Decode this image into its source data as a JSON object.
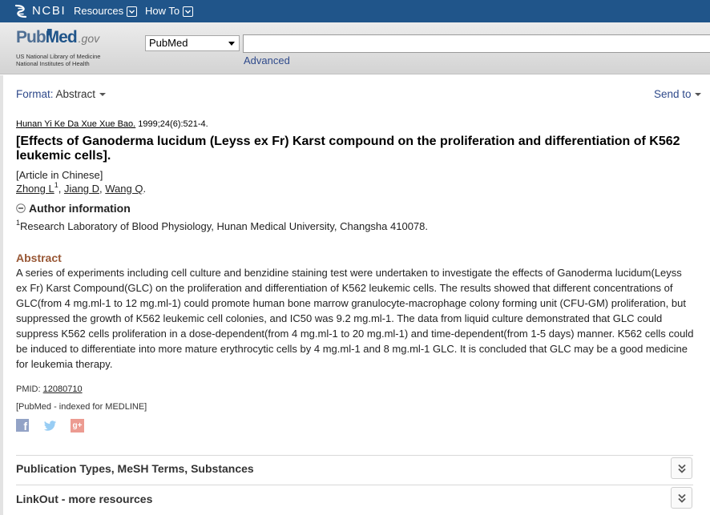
{
  "colors": {
    "ncbi_bar": "#20558a",
    "link": "#2f4a8b",
    "abstract_heading": "#985735"
  },
  "ncbi_bar": {
    "logo_text": "NCBI",
    "logo_icon": "ncbi-helix-icon",
    "menus": [
      {
        "label": "Resources",
        "icon": "chevron-down-icon"
      },
      {
        "label": "How To",
        "icon": "chevron-down-icon"
      }
    ]
  },
  "header": {
    "logo": {
      "pub": "Pub",
      "med": "Med",
      "gov": ".gov",
      "line1": "US National Library of Medicine",
      "line2": "National Institutes of Health"
    },
    "database_select": {
      "value": "PubMed"
    },
    "search": {
      "value": ""
    },
    "advanced_label": "Advanced"
  },
  "format_bar": {
    "format_label": "Format:",
    "format_value": "Abstract",
    "send_to_label": "Send to"
  },
  "article": {
    "journal": "Hunan Yi Ke Da Xue Xue Bao.",
    "citation": "1999;24(6):521-4.",
    "title": "[Effects of Ganoderma lucidum (Leyss ex Fr) Karst compound on the proliferation and differentiation of K562 leukemic cells].",
    "language_note": "[Article in Chinese]",
    "authors": [
      {
        "name": "Zhong L",
        "sup": "1",
        "sep": ", "
      },
      {
        "name": "Jiang D",
        "sep": ", "
      },
      {
        "name": "Wang Q",
        "sep": "."
      }
    ],
    "author_info_label": "Author information",
    "author_info_icon": "minus-circle-icon",
    "affiliation": {
      "sup": "1",
      "text": "Research Laboratory of Blood Physiology, Hunan Medical University, Changsha 410078."
    },
    "abstract_heading": "Abstract",
    "abstract_text": "A series of experiments including cell culture and benzidine staining test were undertaken to investigate the effects of Ganoderma lucidum(Leyss ex Fr) Karst Compound(GLC) on the proliferation and differentiation of K562 leukemic cells. The results showed that different concentrations of GLC(from 4 mg.ml-1 to 12 mg.ml-1) could promote human bone marrow granulocyte-macrophage colony forming unit (CFU-GM) proliferation, but suppressed the growth of K562 leukemic cell colonies, and IC50 was 9.2 mg.ml-1. The data from liquid culture demonstrated that GLC could suppress K562 cells proliferation in a dose-dependent(from 4 mg.ml-1 to 20 mg.ml-1) and time-dependent(from 1-5 days) manner. K562 cells could be induced to differentiate into more mature erythrocytic cells by 4 mg.ml-1 and 8 mg.ml-1 GLC. It is concluded that GLC may be a good medicine for leukemia therapy.",
    "pmid_label": "PMID:",
    "pmid": "12080710",
    "status": "[PubMed - indexed for MEDLINE]",
    "share": [
      {
        "icon": "facebook-icon",
        "glyph": "f"
      },
      {
        "icon": "twitter-icon"
      },
      {
        "icon": "google-plus-icon",
        "glyph": "g+"
      }
    ]
  },
  "sections": [
    {
      "label": "Publication Types, MeSH Terms, Substances",
      "icon": "double-chevron-down-icon"
    },
    {
      "label": "LinkOut - more resources",
      "icon": "double-chevron-down-icon"
    }
  ]
}
